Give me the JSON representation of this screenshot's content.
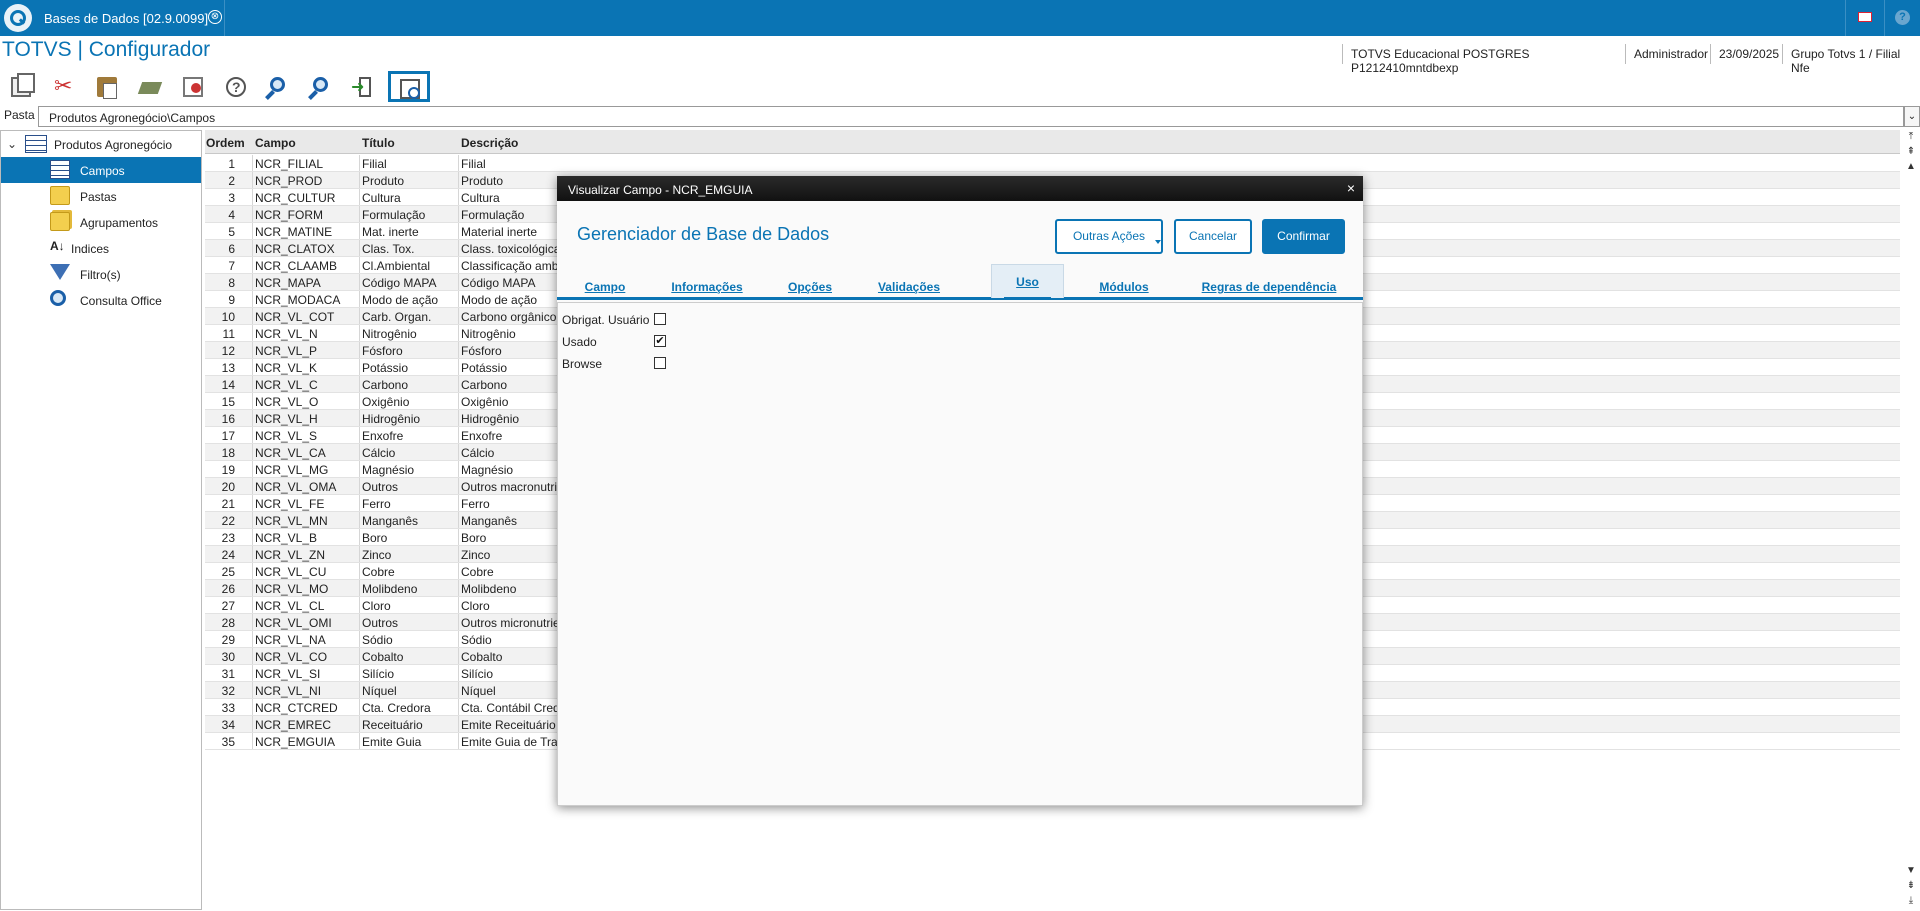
{
  "topbar": {
    "tab_title": "Bases de Dados [02.9.0099]",
    "tab_close_symbol": "⊗",
    "mail_icon": "mail-icon",
    "help_symbol": "?"
  },
  "header": {
    "app_title": "TOTVS | Configurador",
    "environment": "TOTVS Educacional POSTGRES P1212410mntdbexp",
    "user": "Administrador",
    "date": "23/09/2025",
    "branch": "Grupo Totvs 1 / Filial Nfe"
  },
  "toolbar": {
    "icons": [
      "copy-icon",
      "cut-icon",
      "paste-icon",
      "book-icon",
      "documents-icon",
      "help-icon",
      "search-icon",
      "search-next-icon",
      "exit-icon",
      "view-icon"
    ]
  },
  "pasta": {
    "label": "Pasta",
    "value": "Produtos Agronegócio\\Campos",
    "dropdown_symbol": "⌄"
  },
  "tree": {
    "root_label": "Produtos Agronegócio",
    "chevron": "⌄",
    "items": [
      {
        "label": "Campos",
        "icon": "table-icon",
        "selected": true
      },
      {
        "label": "Pastas",
        "icon": "folder-icon",
        "selected": false
      },
      {
        "label": "Agrupamentos",
        "icon": "folders-icon",
        "selected": false
      },
      {
        "label": "Indices",
        "icon": "index-icon",
        "selected": false
      },
      {
        "label": "Filtro(s)",
        "icon": "filter-icon",
        "selected": false
      },
      {
        "label": "Consulta Office",
        "icon": "magnifier-icon",
        "selected": false
      }
    ]
  },
  "grid": {
    "headers": [
      "Ordem",
      "Campo",
      "Título",
      "Descrição"
    ],
    "rows": [
      [
        "1",
        "NCR_FILIAL",
        "Filial",
        "Filial"
      ],
      [
        "2",
        "NCR_PROD",
        "Produto",
        "Produto"
      ],
      [
        "3",
        "NCR_CULTUR",
        "Cultura",
        "Cultura"
      ],
      [
        "4",
        "NCR_FORM",
        "Formulação",
        "Formulação"
      ],
      [
        "5",
        "NCR_MATINE",
        "Mat. inerte",
        "Material inerte"
      ],
      [
        "6",
        "NCR_CLATOX",
        "Clas. Tox.",
        "Class. toxicológica"
      ],
      [
        "7",
        "NCR_CLAAMB",
        "Cl.Ambiental",
        "Classificação ambie"
      ],
      [
        "8",
        "NCR_MAPA",
        "Código MAPA",
        "Código MAPA"
      ],
      [
        "9",
        "NCR_MODACA",
        "Modo de ação",
        "Modo de ação"
      ],
      [
        "10",
        "NCR_VL_COT",
        "Carb. Organ.",
        "Carbono orgânico to"
      ],
      [
        "11",
        "NCR_VL_N",
        "Nitrogênio",
        "Nitrogênio"
      ],
      [
        "12",
        "NCR_VL_P",
        "Fósforo",
        "Fósforo"
      ],
      [
        "13",
        "NCR_VL_K",
        "Potássio",
        "Potássio"
      ],
      [
        "14",
        "NCR_VL_C",
        "Carbono",
        "Carbono"
      ],
      [
        "15",
        "NCR_VL_O",
        "Oxigênio",
        "Oxigênio"
      ],
      [
        "16",
        "NCR_VL_H",
        "Hidrogênio",
        "Hidrogênio"
      ],
      [
        "17",
        "NCR_VL_S",
        "Enxofre",
        "Enxofre"
      ],
      [
        "18",
        "NCR_VL_CA",
        "Cálcio",
        "Cálcio"
      ],
      [
        "19",
        "NCR_VL_MG",
        "Magnésio",
        "Magnésio"
      ],
      [
        "20",
        "NCR_VL_OMA",
        "Outros",
        "Outros macronutrien"
      ],
      [
        "21",
        "NCR_VL_FE",
        "Ferro",
        "Ferro"
      ],
      [
        "22",
        "NCR_VL_MN",
        "Manganês",
        "Manganês"
      ],
      [
        "23",
        "NCR_VL_B",
        "Boro",
        "Boro"
      ],
      [
        "24",
        "NCR_VL_ZN",
        "Zinco",
        "Zinco"
      ],
      [
        "25",
        "NCR_VL_CU",
        "Cobre",
        "Cobre"
      ],
      [
        "26",
        "NCR_VL_MO",
        "Molibdeno",
        "Molibdeno"
      ],
      [
        "27",
        "NCR_VL_CL",
        "Cloro",
        "Cloro"
      ],
      [
        "28",
        "NCR_VL_OMI",
        "Outros",
        "Outros micronutrien"
      ],
      [
        "29",
        "NCR_VL_NA",
        "Sódio",
        "Sódio"
      ],
      [
        "30",
        "NCR_VL_CO",
        "Cobalto",
        "Cobalto"
      ],
      [
        "31",
        "NCR_VL_SI",
        "Silício",
        "Silício"
      ],
      [
        "32",
        "NCR_VL_NI",
        "Níquel",
        "Níquel"
      ],
      [
        "33",
        "NCR_CTCRED",
        "Cta. Credora",
        "Cta. Contábil Credo"
      ],
      [
        "34",
        "NCR_EMREC",
        "Receituário",
        "Emite Receituário"
      ],
      [
        "35",
        "NCR_EMGUIA",
        "Emite Guia",
        "Emite Guia de Trans"
      ]
    ]
  },
  "scroll": {
    "top_first": "⤒",
    "up_page": "⇞",
    "up": "▲",
    "down": "▼",
    "down_page": "⇟",
    "bottom_last": "⤓"
  },
  "dialog": {
    "title": "Visualizar Campo - NCR_EMGUIA",
    "close_symbol": "×",
    "heading": "Gerenciador de Base de Dados",
    "buttons": {
      "more_actions": "Outras Ações",
      "cancel": "Cancelar",
      "confirm": "Confirmar"
    },
    "tabs": [
      "Campo",
      "Informações",
      "Opções",
      "Validações",
      "Uso",
      "Módulos",
      "Regras de dependência"
    ],
    "active_tab": "Uso",
    "checkboxes": [
      {
        "label": "Obrigat. Usuário",
        "checked": false
      },
      {
        "label": "Usado",
        "checked": true
      },
      {
        "label": "Browse",
        "checked": false
      }
    ],
    "check_symbol": "✔"
  },
  "colors": {
    "brand": "#0a74b4",
    "dialog_title_bg": "#1b1b1b",
    "selected_row": "#0a74b4"
  }
}
